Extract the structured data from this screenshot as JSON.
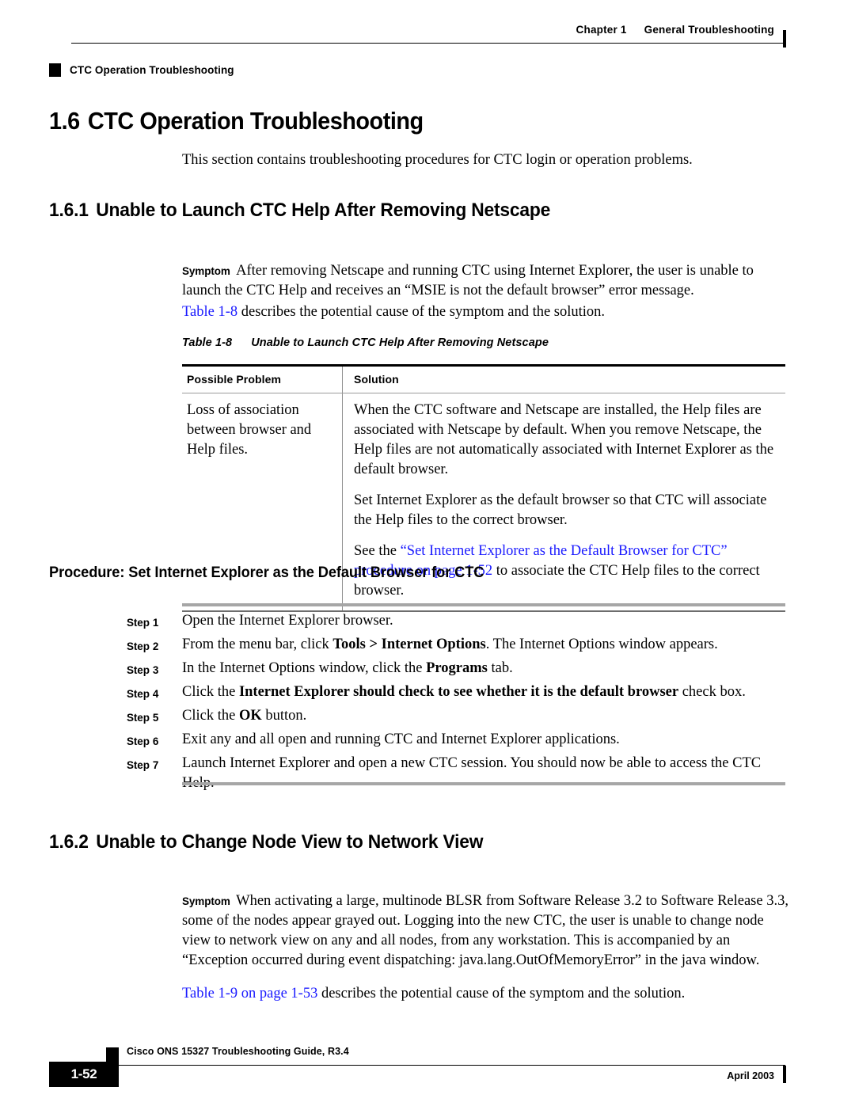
{
  "header": {
    "chapter_label": "Chapter 1",
    "chapter_title": "General Troubleshooting",
    "running_title": "CTC Operation Troubleshooting"
  },
  "section": {
    "number": "1.6",
    "title": "CTC Operation Troubleshooting",
    "intro": "This section contains troubleshooting procedures for CTC login or operation problems."
  },
  "subsection_1": {
    "number": "1.6.1",
    "title": "Unable to Launch CTC Help After Removing Netscape",
    "symptom_label": "Symptom",
    "symptom_text": "After removing Netscape and running CTC using Internet Explorer, the user is unable to launch the CTC Help and receives an “MSIE is not the default browser” error message.",
    "table_ref_link": "Table 1-8",
    "table_ref_rest": " describes the potential cause of the symptom and the solution."
  },
  "table_1_8": {
    "caption_number": "Table 1-8",
    "caption_title": "Unable to Launch CTC Help After Removing Netscape",
    "headers": [
      "Possible Problem",
      "Solution"
    ],
    "rows": [
      {
        "problem": "Loss of association between browser and Help files.",
        "solution_paragraphs": [
          "When the CTC software and Netscape are installed, the Help files are associated with Netscape by default. When you remove Netscape, the Help files are not automatically associated with Internet Explorer as the default browser.",
          "Set Internet Explorer as the default browser so that CTC will associate the Help files to the correct browser."
        ],
        "solution_link_paragraph": {
          "prefix": "See the ",
          "link": "“Set Internet Explorer as the Default Browser for CTC” procedure on page 1-52",
          "suffix": " to associate the CTC Help files to the correct browser."
        }
      }
    ]
  },
  "procedure": {
    "title": "Procedure: Set Internet Explorer as the Default Browser for CTC",
    "step_label": "Step",
    "steps": [
      {
        "number": "1",
        "parts": [
          {
            "t": "Open the Internet Explorer browser.",
            "b": false
          }
        ]
      },
      {
        "number": "2",
        "parts": [
          {
            "t": "From the menu bar, click ",
            "b": false
          },
          {
            "t": "Tools > Internet Options",
            "b": true
          },
          {
            "t": ". The Internet Options window appears.",
            "b": false
          }
        ]
      },
      {
        "number": "3",
        "parts": [
          {
            "t": "In the Internet Options window, click the ",
            "b": false
          },
          {
            "t": "Programs",
            "b": true
          },
          {
            "t": " tab.",
            "b": false
          }
        ]
      },
      {
        "number": "4",
        "parts": [
          {
            "t": "Click the ",
            "b": false
          },
          {
            "t": "Internet Explorer should check to see whether it is the default browser",
            "b": true
          },
          {
            "t": " check box.",
            "b": false
          }
        ]
      },
      {
        "number": "5",
        "parts": [
          {
            "t": "Click the ",
            "b": false
          },
          {
            "t": "OK",
            "b": true
          },
          {
            "t": " button.",
            "b": false
          }
        ]
      },
      {
        "number": "6",
        "parts": [
          {
            "t": "Exit any and all open and running CTC and Internet Explorer applications.",
            "b": false
          }
        ]
      },
      {
        "number": "7",
        "parts": [
          {
            "t": "Launch Internet Explorer and open a new CTC session. You should now be able to access the CTC Help.",
            "b": false
          }
        ]
      }
    ]
  },
  "subsection_2": {
    "number": "1.6.2",
    "title": "Unable to Change Node View to Network View",
    "symptom_label": "Symptom",
    "symptom_text": "When activating a large, multinode BLSR from Software Release 3.2 to Software Release 3.3, some of the nodes appear grayed out. Logging into the new CTC, the user is unable to change node view to network view on any and all nodes, from any workstation. This is accompanied by an “Exception occurred during event dispatching: java.lang.OutOfMemoryError” in the java window.",
    "table_ref_link": "Table 1-9 on page 1-53",
    "table_ref_rest": " describes the potential cause of the symptom and the solution."
  },
  "footer": {
    "guide_title": "Cisco ONS 15327 Troubleshooting Guide, R3.4",
    "page_number": "1-52",
    "date": "April 2003"
  },
  "colors": {
    "link": "#1a1aff",
    "rule": "#a6a6a6",
    "text": "#000000"
  }
}
